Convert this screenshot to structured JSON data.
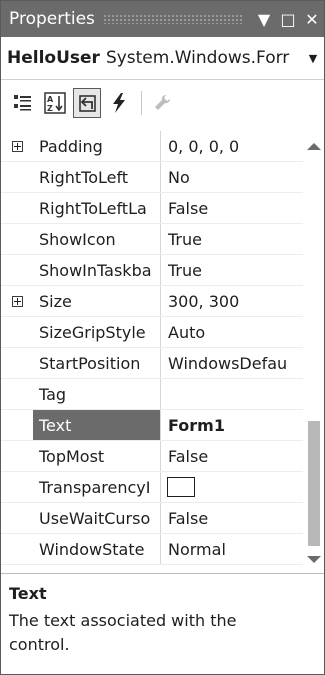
{
  "window": {
    "title": "Properties",
    "pin_glyph": "▼",
    "maximize_glyph": "□",
    "close_glyph": "✕"
  },
  "selector": {
    "object_name": "HelloUser",
    "object_type": "System.Windows.Forr",
    "dropdown_glyph": "▼"
  },
  "toolbar": {
    "buttons": [
      {
        "name": "categorized",
        "icon": "categorized-icon"
      },
      {
        "name": "alphabetical",
        "icon": "alphabetical-icon"
      },
      {
        "name": "properties",
        "icon": "properties-icon",
        "pressed": true
      },
      {
        "name": "events",
        "icon": "lightning-icon"
      },
      {
        "name": "property-pages",
        "icon": "wrench-icon"
      }
    ]
  },
  "properties": [
    {
      "name": "Padding",
      "value": "0, 0, 0, 0",
      "expandable": true
    },
    {
      "name": "RightToLeft",
      "value": "No"
    },
    {
      "name": "RightToLeftLa",
      "value": "False"
    },
    {
      "name": "ShowIcon",
      "value": "True"
    },
    {
      "name": "ShowInTaskba",
      "value": "True"
    },
    {
      "name": "Size",
      "value": "300, 300",
      "expandable": true
    },
    {
      "name": "SizeGripStyle",
      "value": "Auto"
    },
    {
      "name": "StartPosition",
      "value": "WindowsDefau"
    },
    {
      "name": "Tag",
      "value": ""
    },
    {
      "name": "Text",
      "value": "Form1",
      "selected": true
    },
    {
      "name": "TopMost",
      "value": "False"
    },
    {
      "name": "TransparencyI",
      "value": "",
      "swatch": true
    },
    {
      "name": "UseWaitCurso",
      "value": "False"
    },
    {
      "name": "WindowState",
      "value": "Normal"
    }
  ],
  "description": {
    "title": "Text",
    "text": "The text associated with the control."
  },
  "colors": {
    "title_bar": "#6b6b6b",
    "selected_row": "#6b6b6b",
    "scroll_thumb": "#b8b8b8"
  }
}
